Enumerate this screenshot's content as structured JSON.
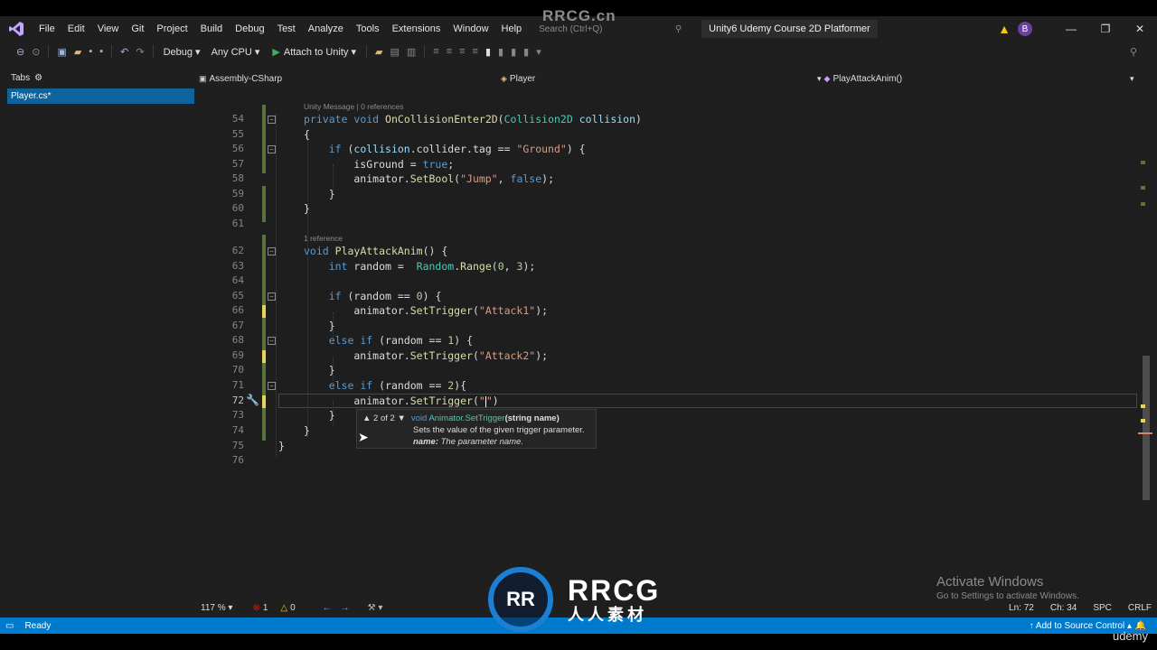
{
  "watermark": {
    "top": "RRCG.cn",
    "logo_text": "RRCG",
    "logo_sub": "人人素材",
    "logo_mark": "RR"
  },
  "udemy": "udemy",
  "menu": {
    "items": [
      "File",
      "Edit",
      "View",
      "Git",
      "Project",
      "Build",
      "Debug",
      "Test",
      "Analyze",
      "Tools",
      "Extensions",
      "Window",
      "Help"
    ],
    "search_placeholder": "Search (Ctrl+Q)",
    "window_title": "Unity6 Udemy Course 2D Platformer",
    "avatar_letter": "B"
  },
  "toolbar": {
    "config": "Debug",
    "platform": "Any CPU",
    "attach_label": "Attach to Unity"
  },
  "tabs_panel": {
    "header": "Tabs",
    "open_file": "Player.cs*"
  },
  "navbar": {
    "project": "Assembly-CSharp",
    "class": "Player",
    "member": "PlayAttackAnim()"
  },
  "code": {
    "lens_unity": "Unity Message | 0 references",
    "lens_ref": "1 reference",
    "line_numbers": [
      "54",
      "55",
      "56",
      "57",
      "58",
      "59",
      "60",
      "61",
      "62",
      "63",
      "64",
      "65",
      "66",
      "67",
      "68",
      "69",
      "70",
      "71",
      "72",
      "73",
      "74",
      "75",
      "76"
    ]
  },
  "tooltip": {
    "counter": "2 of 2",
    "sig_kw": "void",
    "sig_name": "Animator.SetTrigger",
    "sig_params": "(string name)",
    "desc": "Sets the value of the given trigger parameter.",
    "param_name": "name:",
    "param_desc": "The parameter name."
  },
  "footer": {
    "zoom": "117 %",
    "errors": "1",
    "warnings": "0",
    "line": "Ln: 72",
    "col": "Ch: 34",
    "spc": "SPC",
    "eol": "CRLF"
  },
  "activate": {
    "title": "Activate Windows",
    "sub": "Go to Settings to activate Windows."
  },
  "status": {
    "ready": "Ready",
    "source_control": "Add to Source Control"
  }
}
